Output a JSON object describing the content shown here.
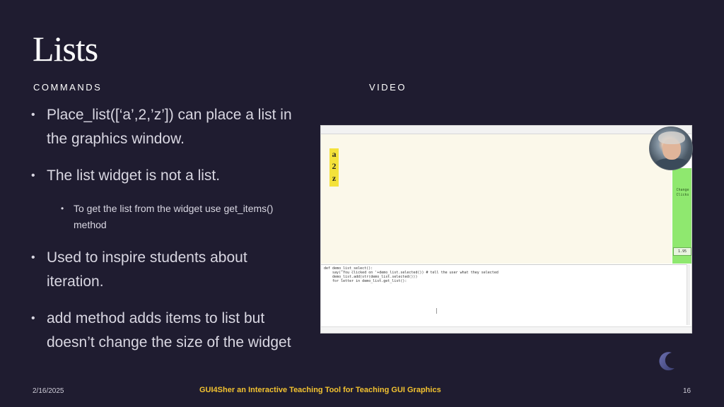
{
  "slide": {
    "title": "Lists",
    "commands_label": "COMMANDS",
    "video_label": "VIDEO",
    "bullets": [
      {
        "level": 1,
        "lines": [
          "Place_list([‘a’,2,’z’]) can place a list in",
          "the graphics window."
        ]
      },
      {
        "level": 1,
        "lines": [
          "The list widget is not a list."
        ]
      },
      {
        "level": 2,
        "lines": [
          "To get the list from the widget use get_items()",
          "method"
        ]
      },
      {
        "level": 1,
        "lines": [
          "Used to inspire students about",
          "iteration."
        ]
      },
      {
        "level": 1,
        "lines": [
          "add method adds items to list but",
          "doesn’t change the size of the widget"
        ]
      }
    ],
    "bullet_symbol": "•"
  },
  "video": {
    "list_items": [
      "a",
      "2",
      "z"
    ],
    "side_label_lines": [
      "Change",
      "Clicks"
    ],
    "side_button": "1.95",
    "code_lines": [
      "def demo_list_select():",
      "    say('You clicked on '+demo_list.selected()) # tell the user what they selected",
      "    demo_list.add(str(demo_list.selected()))",
      "    for letter in demo_list.get_list():"
    ]
  },
  "footer": {
    "date": "2/16/2025",
    "center": "GUI4Sher an Interactive Teaching Tool for Teaching GUI Graphics",
    "page": "16"
  },
  "colors": {
    "background": "#1f1c30",
    "footer_accent": "#f2c230",
    "list_widget": "#f4e23a",
    "sidebar": "#8fe86f"
  },
  "icons": [
    "moon-icon",
    "webcam-thumbnail"
  ]
}
